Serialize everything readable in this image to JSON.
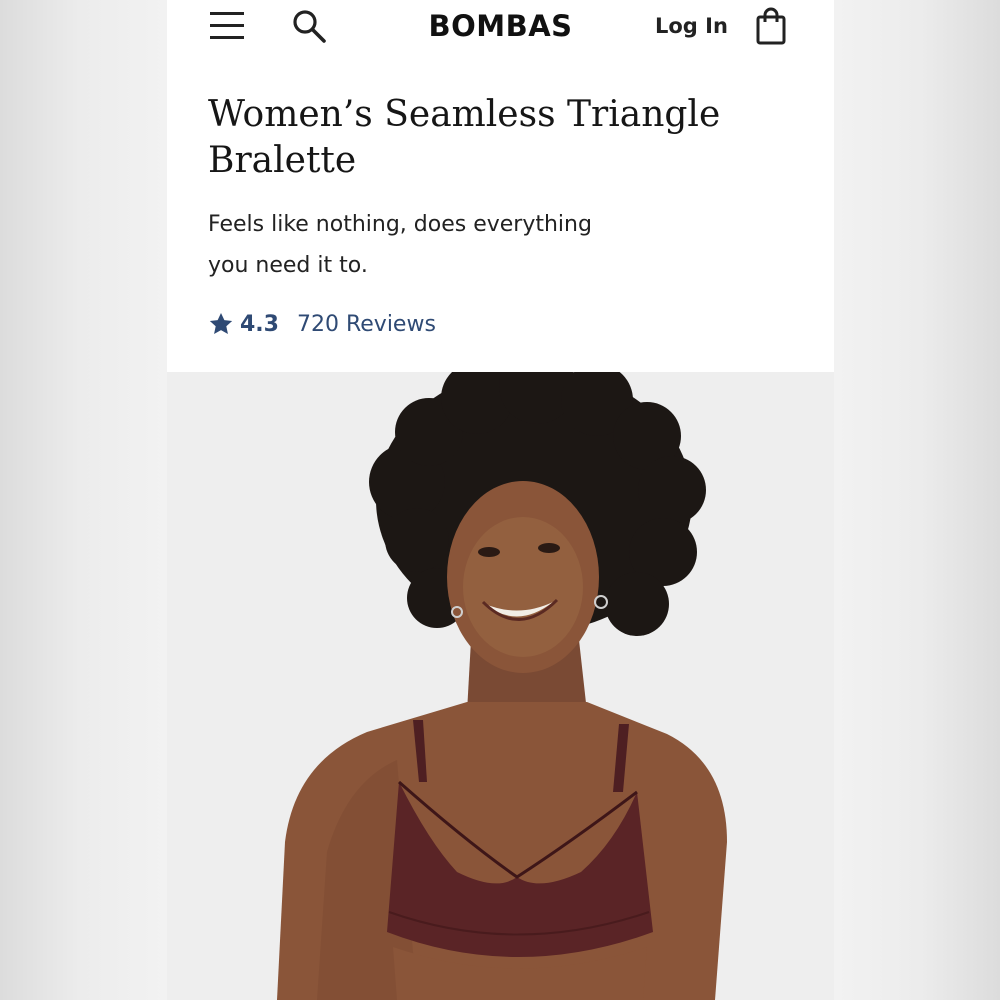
{
  "header": {
    "brand": "BOMBAS",
    "login_label": "Log In",
    "icons": [
      "menu-icon",
      "search-icon",
      "shopping-bag-icon"
    ]
  },
  "product": {
    "title": "Women’s Seamless Triangle Bralette",
    "subtitle": "Feels like nothing, does everything you need it to.",
    "rating": "4.3",
    "reviews": "720 Reviews"
  },
  "colors": {
    "accent": "#2f4a74",
    "text": "#161616",
    "background": "#ffffff",
    "photo_background": "#eeeeee",
    "garment": "#5a2426"
  }
}
